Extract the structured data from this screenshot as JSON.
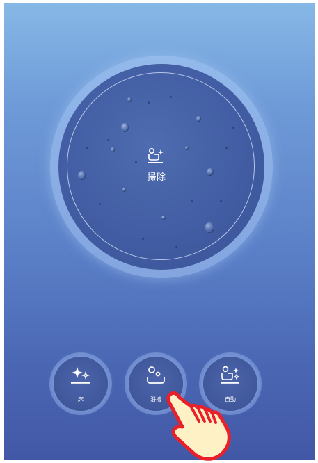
{
  "dial": {
    "label": "掃除",
    "icon": "bath-sparkle-icon"
  },
  "modes": [
    {
      "label": "床",
      "icon": "sparkle-floor-icon"
    },
    {
      "label": "浴槽",
      "icon": "bathtub-icon"
    },
    {
      "label": "自動",
      "icon": "bath-sparkle-icon"
    }
  ],
  "overlay": {
    "icon": "pointing-hand-icon"
  },
  "colors": {
    "background_top": "#86b8e6",
    "background_bottom": "#4258a6",
    "dial": "#425da3",
    "button": "#3f569a",
    "hand": "#fff1c6",
    "hand_outline": "#e8202a"
  }
}
